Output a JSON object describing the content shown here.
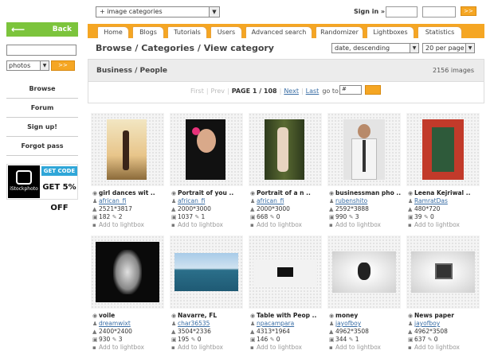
{
  "top": {
    "category_select": "+ image categories",
    "signin_label": "Sign in »",
    "go_label": ">>"
  },
  "sidebar": {
    "back_label": "Back",
    "search_type": "photos",
    "menu": [
      "Browse",
      "Forum",
      "Sign up!",
      "Forgot pass"
    ],
    "promo": {
      "brand": "iStockphoto",
      "code": "GET CODE",
      "discount": "GET 5% OFF"
    }
  },
  "tabs": [
    "Home",
    "Blogs",
    "Tutorials",
    "Users",
    "Advanced search",
    "Randomizer",
    "Lightboxes",
    "Statistics"
  ],
  "breadcrumb": "Browse / Categories / View category",
  "sort": {
    "order": "date, descending",
    "per_page": "20 per page"
  },
  "panel": {
    "title": "Business / People",
    "count": "2156 images",
    "pager": {
      "first": "First",
      "prev": "Prev",
      "current": "PAGE 1 / 108",
      "next": "Next",
      "last": "Last",
      "goto": "go to",
      "goto_value": "#"
    }
  },
  "add_to_lightbox": "Add to lightbox",
  "items": [
    {
      "title": "girl dances wit ..",
      "user": "african_fi",
      "size": "2521*3817",
      "views": "182",
      "comments": "2"
    },
    {
      "title": "Portrait of you ..",
      "user": "african_fi",
      "size": "2000*3000",
      "views": "1037",
      "comments": "1"
    },
    {
      "title": "Portrait of a n ..",
      "user": "african_fi",
      "size": "2000*3000",
      "views": "668",
      "comments": "0"
    },
    {
      "title": "businessman pho ..",
      "user": "rubenshito",
      "size": "2592*3888",
      "views": "990",
      "comments": "3"
    },
    {
      "title": "Leena Kejriwal ..",
      "user": "RamratDas",
      "size": "480*720",
      "views": "39",
      "comments": "0"
    },
    {
      "title": "voile",
      "user": "dreamwixt",
      "size": "2400*2400",
      "views": "930",
      "comments": "3"
    },
    {
      "title": "Navarre, FL",
      "user": "char36535",
      "size": "3504*2336",
      "views": "195",
      "comments": "0"
    },
    {
      "title": "Table with Peop ..",
      "user": "npacampara",
      "size": "4313*1964",
      "views": "146",
      "comments": "0"
    },
    {
      "title": "money",
      "user": "jayofboy",
      "size": "4962*3508",
      "views": "344",
      "comments": "1"
    },
    {
      "title": "News paper",
      "user": "jayofboy",
      "size": "4962*3508",
      "views": "637",
      "comments": "0"
    }
  ]
}
